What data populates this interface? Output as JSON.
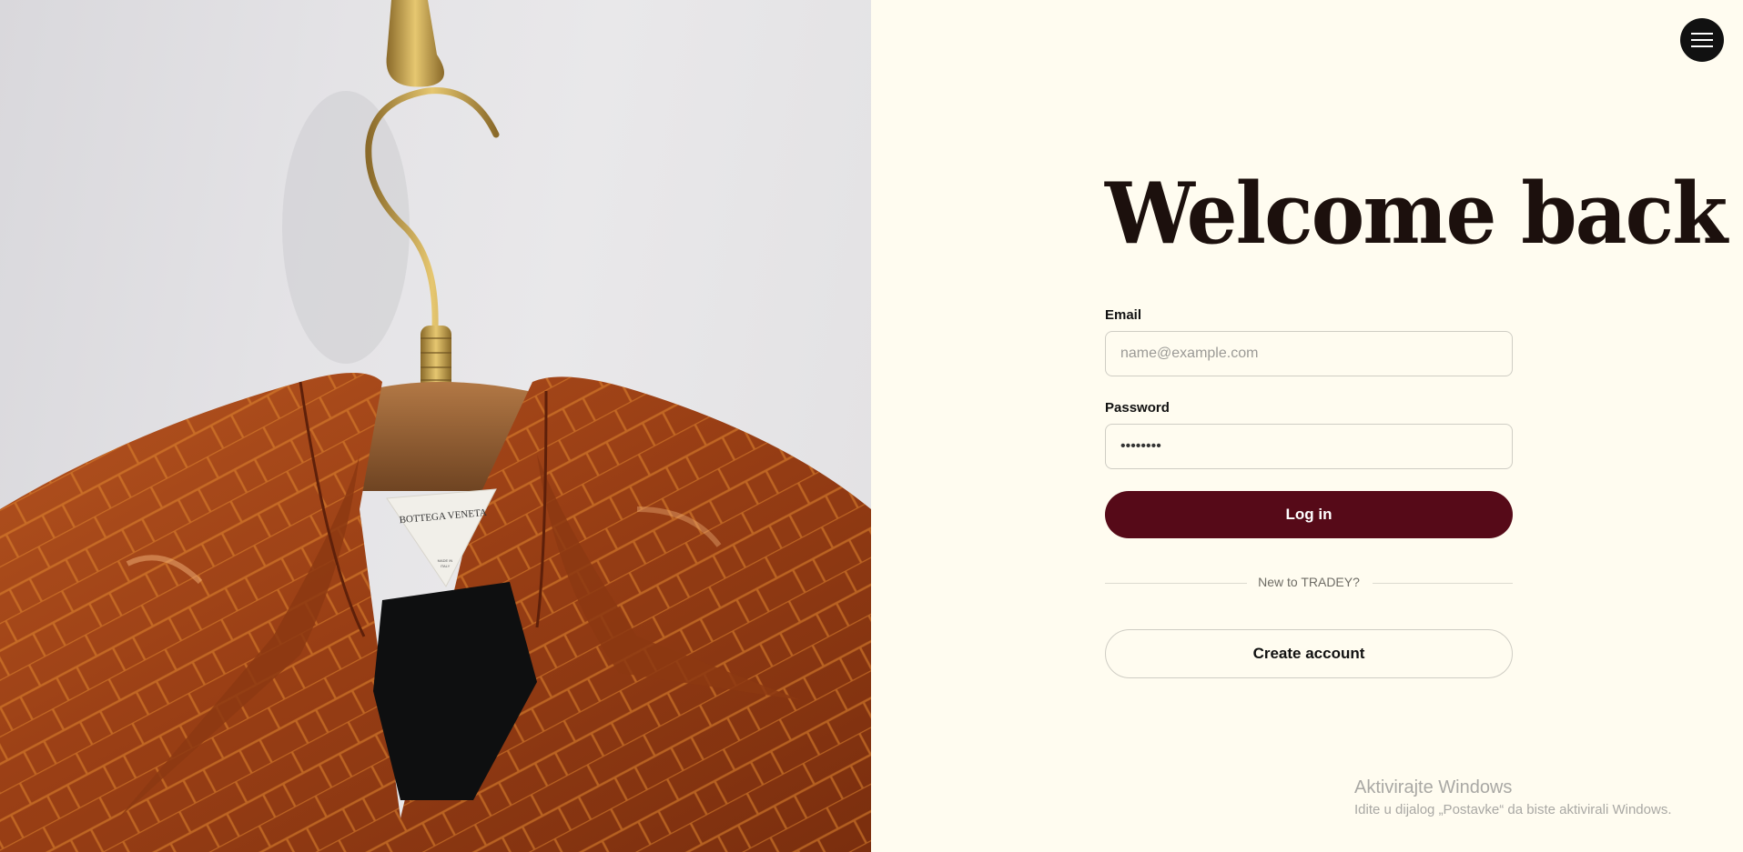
{
  "hero": {
    "label_brand": "BOTTEGA VENETA",
    "label_origin_1": "MADE IN",
    "label_origin_2": "ITALY"
  },
  "header": {
    "menu_icon": "hamburger-menu-icon"
  },
  "login": {
    "title": "Welcome back",
    "email_label": "Email",
    "email_placeholder": "name@example.com",
    "password_label": "Password",
    "password_value": "••••••••",
    "submit_label": "Log in",
    "divider_text": "New to TRADEY?",
    "create_label": "Create account"
  },
  "watermark": {
    "line1": "Aktivirajte Windows",
    "line2": "Idite u dijalog „Postavke“ da biste aktivirali Windows."
  },
  "colors": {
    "panel_bg": "#fffcf0",
    "primary": "#560a18",
    "title": "#1c100d",
    "menu_bg": "#111111"
  }
}
